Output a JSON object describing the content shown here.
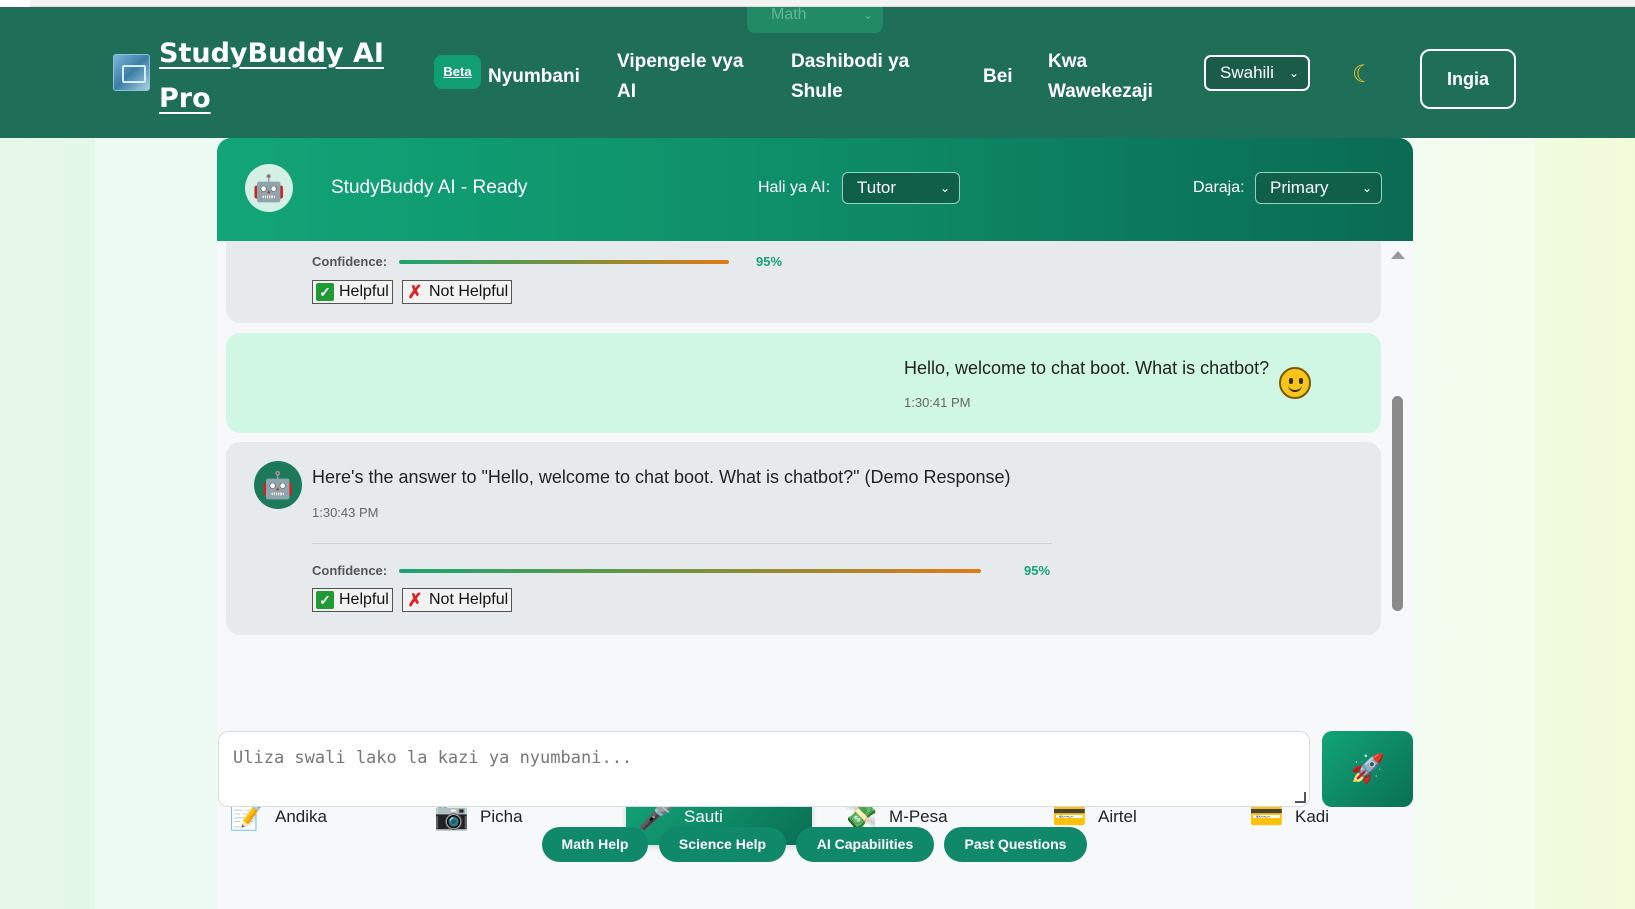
{
  "header": {
    "brand": "StudyBuddy AI Pro",
    "ghost_subject": "Math",
    "beta_badge": "Beta",
    "nav": [
      "Nyumbani",
      "Vipengele vya AI",
      "Dashibodi ya Shule",
      "Bei",
      "Kwa Wawekezaji"
    ],
    "language": "Swahili",
    "theme_icon": "moon-icon",
    "login_label": "Ingia"
  },
  "chat": {
    "status_title": "StudyBuddy AI - Ready",
    "mode_label": "Hali ya AI:",
    "mode_value": "Tutor",
    "level_label": "Daraja:",
    "level_value": "Primary",
    "messages": [
      {
        "role": "bot",
        "confidence_label": "Confidence:",
        "confidence_pct": "95%",
        "confidence_value": 0.95,
        "helpful_label": "Helpful",
        "not_helpful_label": "Not Helpful"
      },
      {
        "role": "user",
        "text": "Hello, welcome to chat boot. What is chatbot?",
        "time": "1:30:41 PM"
      },
      {
        "role": "bot",
        "text": "Here's the answer to \"Hello, welcome to chat boot. What is chatbot?\" (Demo Response)",
        "time": "1:30:43 PM",
        "confidence_label": "Confidence:",
        "confidence_pct": "95%",
        "confidence_value": 0.95,
        "helpful_label": "Helpful",
        "not_helpful_label": "Not Helpful"
      }
    ]
  },
  "input_modes": [
    {
      "label": "Andika",
      "icon": "memo-icon"
    },
    {
      "label": "Picha",
      "icon": "camera-icon"
    },
    {
      "label": "Sauti",
      "icon": "microphone-icon",
      "active": true
    },
    {
      "label": "M-Pesa",
      "icon": "money-icon"
    },
    {
      "label": "Airtel",
      "icon": "card-icon"
    },
    {
      "label": "Kadi",
      "icon": "card-icon"
    }
  ],
  "composer": {
    "placeholder": "Uliza swali lako la kazi ya nyumbani...",
    "send_icon": "rocket-icon"
  },
  "quick_actions": [
    "Math Help",
    "Science Help",
    "AI Capabilities",
    "Past Questions"
  ],
  "colors": {
    "header_bg": "#1f6e57",
    "accent": "#12a578",
    "user_bubble": "#d0f7e3",
    "bot_bubble": "#e7eaed"
  }
}
